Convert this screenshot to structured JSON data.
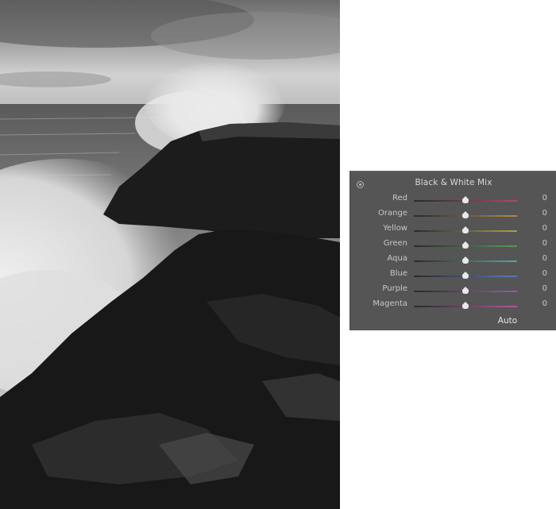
{
  "panel": {
    "title": "Black & White Mix",
    "auto_label": "Auto",
    "sliders": [
      {
        "label": "Red",
        "value": "0",
        "level": 0.5,
        "color": "#b04a68"
      },
      {
        "label": "Orange",
        "value": "0",
        "level": 0.5,
        "color": "#b38a4a"
      },
      {
        "label": "Yellow",
        "value": "0",
        "level": 0.5,
        "color": "#a8a24a"
      },
      {
        "label": "Green",
        "value": "0",
        "level": 0.5,
        "color": "#5a9a5a"
      },
      {
        "label": "Aqua",
        "value": "0",
        "level": 0.5,
        "color": "#5aa6a6"
      },
      {
        "label": "Blue",
        "value": "0",
        "level": 0.5,
        "color": "#5a7ab8"
      },
      {
        "label": "Purple",
        "value": "0",
        "level": 0.5,
        "color": "#9a5ab0"
      },
      {
        "label": "Magenta",
        "value": "0",
        "level": 0.5,
        "color": "#b05a9a"
      }
    ]
  }
}
